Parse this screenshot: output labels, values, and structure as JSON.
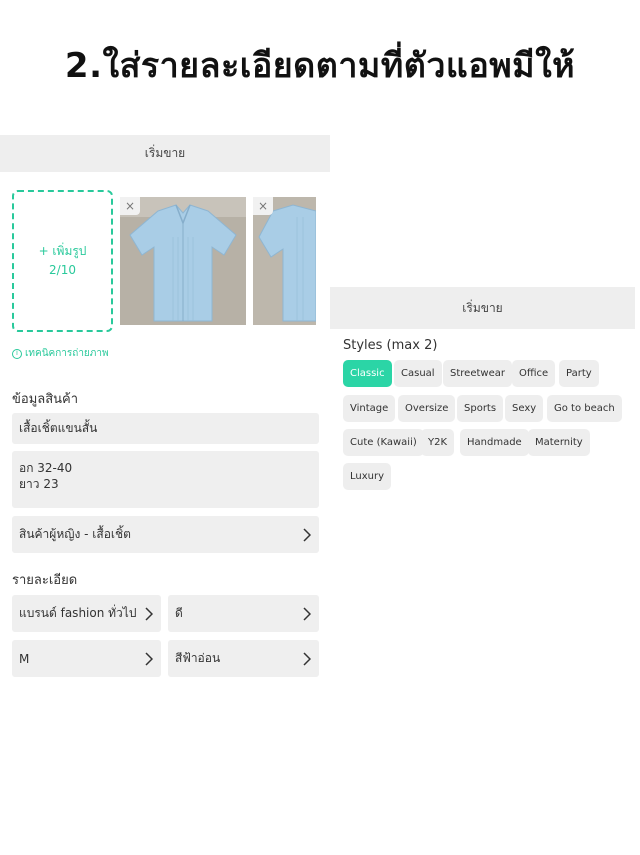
{
  "title": "2.ใส่รายละเอียดตามที่ตัวแอพมีให้",
  "left": {
    "header": "เริ่มขาย",
    "add_photo_label": "+ เพิ่มรูป",
    "photo_count": "2/10",
    "close_symbol": "×",
    "tips": "เทคนิคการถ่ายภาพ",
    "product_info_title": "ข้อมูลสินค้า",
    "product_name": "เสื้อเชิ้ตแขนสั้น",
    "description_line1": "อก 32-40",
    "description_line2": "ยาว 23",
    "category": "สินค้าผู้หญิง - เสื้อเชิ้ต",
    "details_title": "รายละเอียด",
    "brand": "แบรนด์ fashion ทั่วไป",
    "condition": "ดี",
    "size": "M",
    "color": "สีฟ้าอ่อน"
  },
  "right": {
    "header": "เริ่มขาย",
    "styles_label": "Styles (max 2)",
    "chips": [
      "Classic",
      "Casual",
      "Streetwear",
      "Office",
      "Party",
      "Vintage",
      "Oversize",
      "Sports",
      "Sexy",
      "Go to beach",
      "Cute (Kawaii)",
      "Y2K",
      "Handmade",
      "Maternity",
      "Luxury"
    ],
    "selected_chip": "Classic"
  },
  "colors": {
    "accent": "#2bd5a6",
    "field_bg": "#efefef",
    "header_bg": "#eeeeee"
  },
  "icons": [
    "info-icon",
    "chevron-right-icon",
    "close-icon"
  ]
}
